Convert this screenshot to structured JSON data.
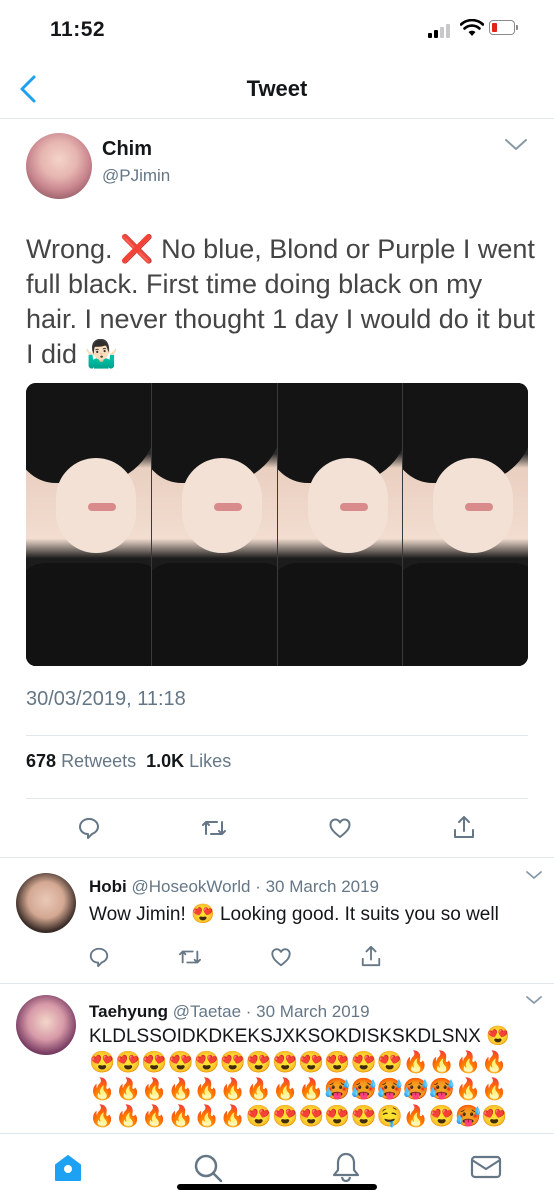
{
  "status_bar": {
    "time": "11:52",
    "battery_level": 0.15,
    "battery_color": "#e2231a"
  },
  "nav": {
    "title": "Tweet",
    "back_icon": "chevron-left-icon",
    "accent": "#1da1f2"
  },
  "tweet": {
    "author_name": "Chim",
    "author_handle": "@PJimin",
    "text": "Wrong. ❌ No blue, Blond or Purple I went full black. First time doing black on my hair. I never thought 1 day I would do it but I did 🤷🏻‍♂️",
    "timestamp": "30/03/2019, 11:18",
    "retweets_count": "678",
    "retweets_label": "Retweets",
    "likes_count": "1.0K",
    "likes_label": "Likes",
    "actions": [
      "reply-icon",
      "retweet-icon",
      "like-icon",
      "share-icon"
    ]
  },
  "replies": [
    {
      "name": "Hobi",
      "meta": "@HoseokWorld · 30 March 2019",
      "text": "Wow Jimin! 😍 Looking good. It suits you so well"
    },
    {
      "name": "Taehyung",
      "meta": "@Taetae · 30 March 2019",
      "text": "KLDLSSOIDKDKEKSJXKSOKDISKSKDLSNX 😍",
      "emoji_line_1": "😍😍😍😍😍😍😍😍😍😍😍😍🔥🔥🔥🔥",
      "emoji_line_2": "🔥🔥🔥🔥🔥🔥🔥🔥🔥🥵🥵🥵🥵🥵🔥🔥",
      "emoji_line_3": "🔥🔥🔥🔥🔥🔥😍😍😍😍😍🤤🔥😍🥵😍"
    }
  ],
  "tab_bar": {
    "items": [
      "home-icon",
      "search-icon",
      "notifications-icon",
      "messages-icon"
    ],
    "active": "home-icon"
  }
}
